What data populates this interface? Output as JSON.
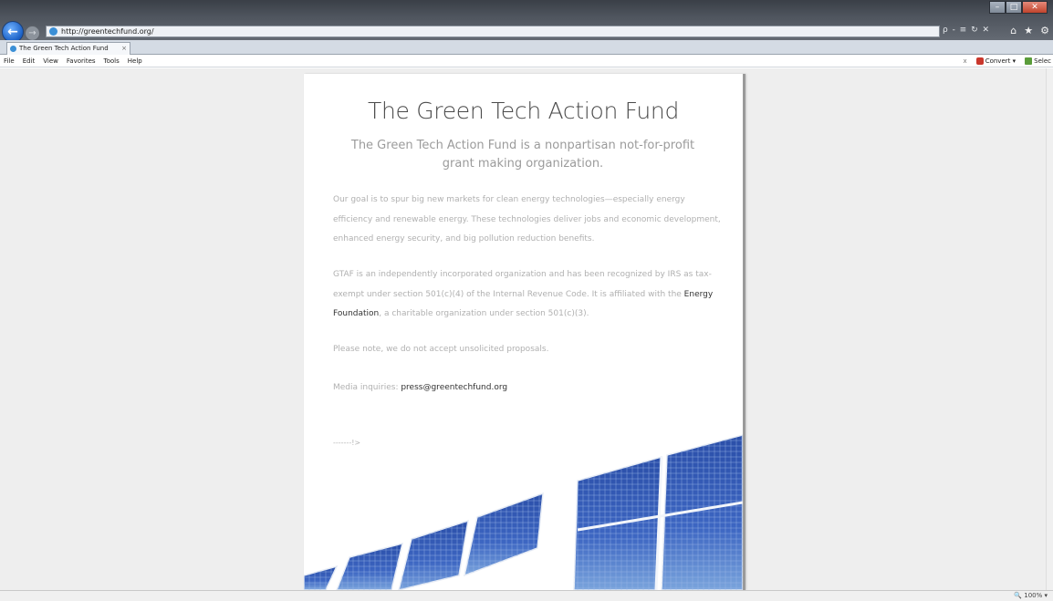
{
  "browser": {
    "address_url": "http://greentechfund.org/",
    "address_right_icons": "ρ - ≡ ↻ ✕",
    "tab_title": "The Green Tech Action Fund",
    "tab_close": "×",
    "toolbar_icons": [
      "home-icon",
      "star-icon",
      "gear-icon"
    ],
    "menu": [
      "File",
      "Edit",
      "View",
      "Favorites",
      "Tools",
      "Help"
    ],
    "menu_right": {
      "close": "x",
      "convert": "Convert",
      "convert_dropdown": "▾",
      "select": "Selec"
    },
    "zoom": "100%"
  },
  "page": {
    "title": "The Green Tech Action Fund",
    "subtitle": "The Green Tech Action Fund is a nonpartisan not-for-profit grant making organization.",
    "paragraph1": "Our goal is to spur big new markets for clean energy technologies—especially energy efficiency and renewable energy. These technologies deliver jobs and economic development, enhanced energy security, and big pollution reduction benefits.",
    "paragraph2_a": "GTAF is an independently incorporated organization and has been recognized by IRS as tax-exempt under section 501(c)(4) of the Internal Revenue Code. It is affiliated with the ",
    "paragraph2_link": "Energy Foundation",
    "paragraph2_b": ", a charitable organization under section 501(c)(3).",
    "paragraph3": "Please note, we do not accept unsolicited proposals.",
    "media_label": "Media inquiries: ",
    "media_email": "press@greentechfund.org",
    "arrow": "-------!>"
  },
  "colors": {
    "panel_blue": "#2e4fa8",
    "panel_light": "#6f9ed8",
    "title_text": "#4a4a4a",
    "body_text": "#b0b0b0"
  }
}
